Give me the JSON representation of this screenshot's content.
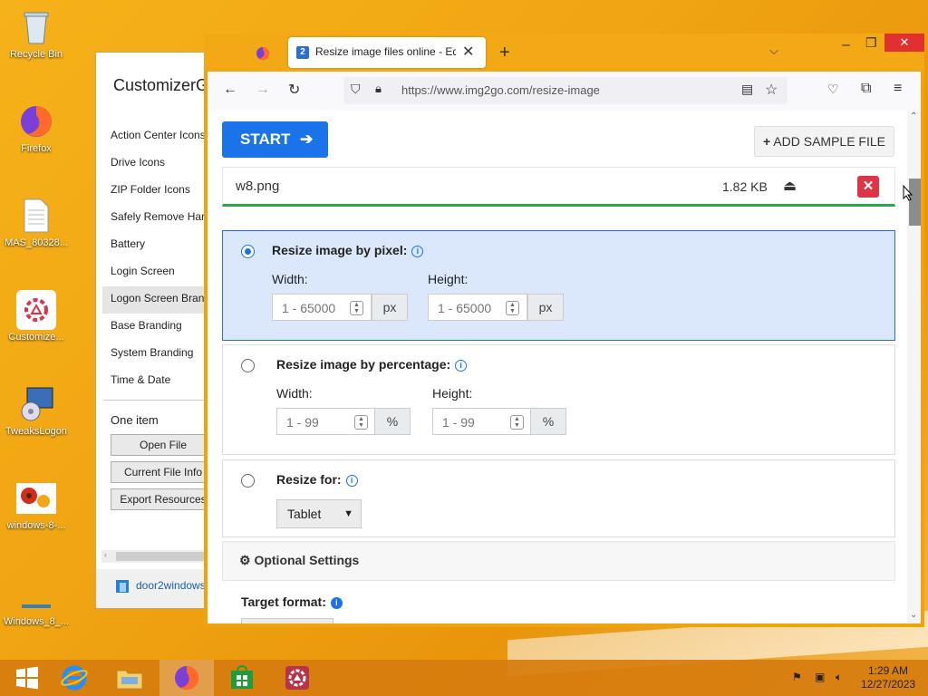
{
  "desktop": {
    "icons": [
      {
        "label": "Recycle Bin"
      },
      {
        "label": "Firefox"
      },
      {
        "label": "MAS_80328..."
      },
      {
        "label": "Customize..."
      },
      {
        "label": "TweaksLogon"
      },
      {
        "label": "windows-8-..."
      },
      {
        "label": "Windows_8_..."
      }
    ]
  },
  "customizer": {
    "title": "CustomizerG",
    "items": [
      "Action Center Icons",
      "Drive Icons",
      "ZIP Folder Icons",
      "Safely Remove Hard",
      "Battery",
      "Login Screen",
      "Logon Screen Brand",
      "Base Branding",
      "System Branding",
      "Time & Date"
    ],
    "selected_item": "Logon Screen Brand",
    "section_label": "One item",
    "buttons": [
      "Open File",
      "Current File Info",
      "Export Resources"
    ],
    "footer_link": "door2windows"
  },
  "browser": {
    "tab_title": "Resize image files online - Edito",
    "url": "https://www.img2go.com/resize-image",
    "page": {
      "start_label": "START",
      "sample_label": "ADD SAMPLE FILE",
      "file": {
        "name": "w8.png",
        "size": "1.82 KB"
      },
      "options": [
        {
          "label": "Resize image by pixel:",
          "selected": true,
          "width_label": "Width:",
          "height_label": "Height:",
          "width_placeholder": "1 - 65000",
          "height_placeholder": "1 - 65000",
          "unit": "px"
        },
        {
          "label": "Resize image by percentage:",
          "selected": false,
          "width_label": "Width:",
          "height_label": "Height:",
          "width_placeholder": "1 - 99",
          "height_placeholder": "1 - 99",
          "unit": "%"
        },
        {
          "label": "Resize for:",
          "selected": false,
          "select_value": "Tablet"
        }
      ],
      "optional_settings": "Optional Settings",
      "target_format_label": "Target format:"
    }
  },
  "taskbar": {
    "time": "1:29 AM",
    "date": "12/27/2023"
  },
  "colors": {
    "accent": "#1a73e8",
    "danger": "#dc3545",
    "success": "#28a745",
    "desktop": "#f0a512"
  }
}
